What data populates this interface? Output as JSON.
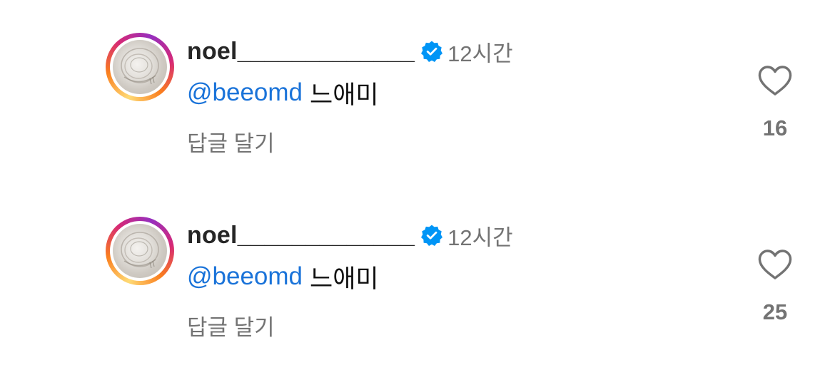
{
  "comments": [
    {
      "username": "noel_____________",
      "time": "12시간",
      "mention": "@beeomd",
      "text": "느애미",
      "reply_label": "답글 달기",
      "likes": "16"
    },
    {
      "username": "noel_____________",
      "time": "12시간",
      "mention": "@beeomd",
      "text": "느애미",
      "reply_label": "답글 달기",
      "likes": "25"
    }
  ],
  "icons": {
    "verified": "verified-badge-icon",
    "like": "heart-outline-icon"
  },
  "colors": {
    "mention": "#1a73d9",
    "verified": "#0095f6",
    "secondary_text": "#737373",
    "primary_text": "#262626"
  }
}
